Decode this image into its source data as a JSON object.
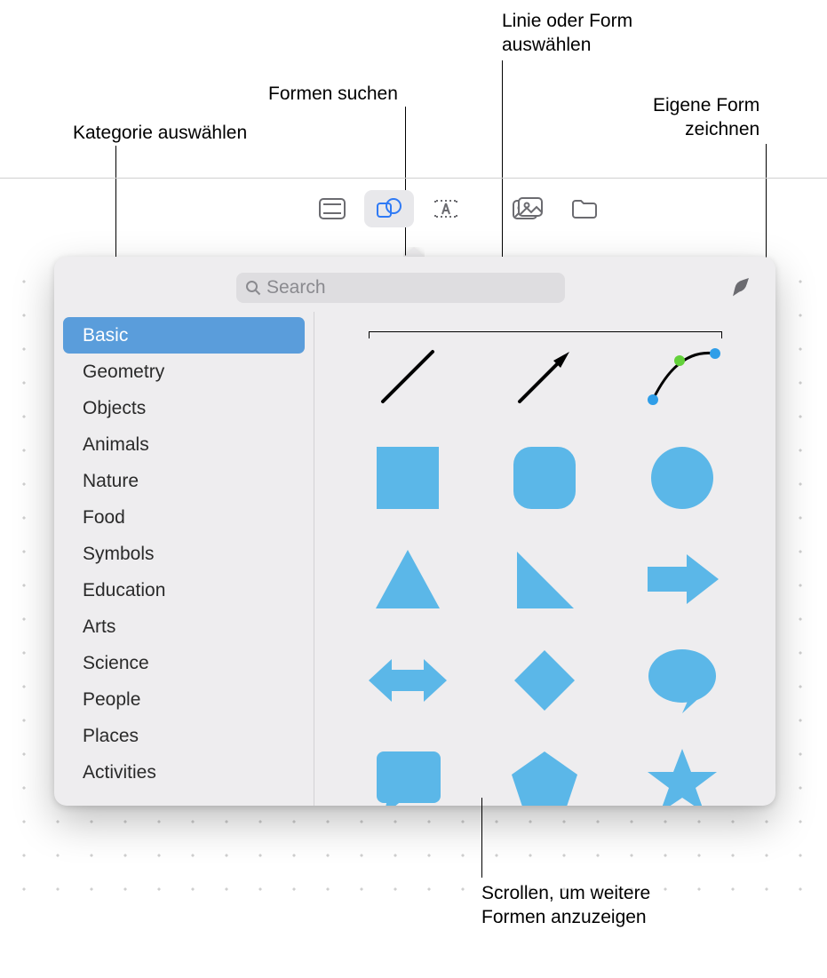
{
  "callouts": {
    "category": "Kategorie auswählen",
    "search_shapes": "Formen suchen",
    "select_line_shape": "Linie oder Form\nauswählen",
    "draw_own": "Eigene Form\nzeichnen",
    "scroll_more": "Scrollen, um weitere\nFormen anzuzeigen"
  },
  "toolbar": {
    "items": [
      {
        "name": "insert-header-footer-icon"
      },
      {
        "name": "insert-shape-icon"
      },
      {
        "name": "insert-textbox-icon"
      },
      {
        "name": "insert-media-icon"
      },
      {
        "name": "insert-file-icon"
      }
    ]
  },
  "search": {
    "placeholder": "Search"
  },
  "sidebar": {
    "items": [
      {
        "label": "Basic",
        "selected": true
      },
      {
        "label": "Geometry"
      },
      {
        "label": "Objects"
      },
      {
        "label": "Animals"
      },
      {
        "label": "Nature"
      },
      {
        "label": "Food"
      },
      {
        "label": "Symbols"
      },
      {
        "label": "Education"
      },
      {
        "label": "Arts"
      },
      {
        "label": "Science"
      },
      {
        "label": "People"
      },
      {
        "label": "Places"
      },
      {
        "label": "Activities"
      }
    ]
  },
  "shapes": {
    "cells": [
      "line",
      "arrow-line",
      "curve-edit",
      "square",
      "rounded-square",
      "circle",
      "triangle",
      "right-triangle",
      "arrow-right",
      "arrow-leftright",
      "diamond",
      "speech-bubble",
      "callout-rect",
      "pentagon",
      "star"
    ],
    "accent": "#5bb7e8"
  }
}
